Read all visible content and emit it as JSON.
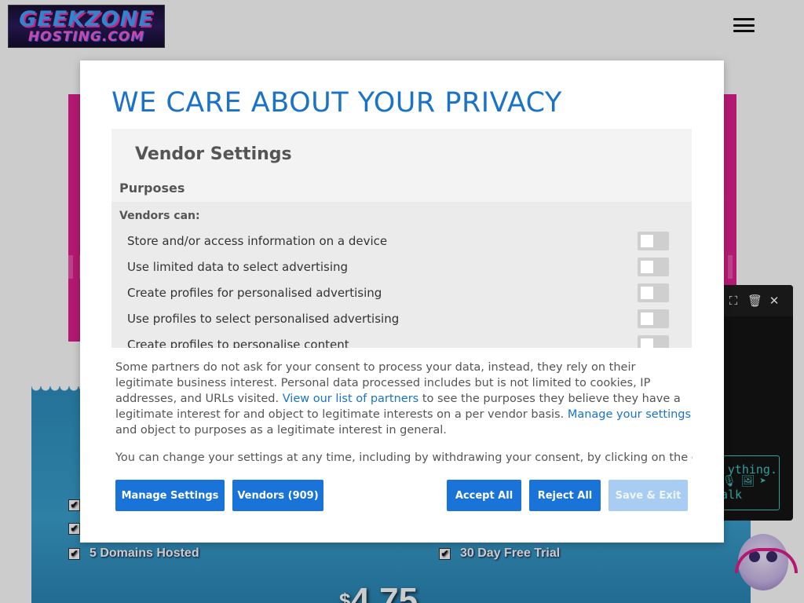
{
  "background": {
    "logo": {
      "line1": "GEEKZONE",
      "line2": "HOSTING.COM"
    },
    "menu_icon": "hamburger-icon",
    "features": [
      {
        "label": "",
        "icon": "checkbox-icon"
      },
      {
        "label": "",
        "icon": "checkbox-icon"
      },
      {
        "label": "5 Domains Hosted",
        "icon": "checkbox-icon"
      },
      {
        "label": "30 Day Free Trial",
        "icon": "checkbox-icon"
      }
    ],
    "check_mark": "✔",
    "price": {
      "currency": "$",
      "amount": "4.75"
    },
    "chat": {
      "expand_icon": "⛶",
      "delete_icon": "🗑",
      "close_icon": "✕",
      "input_line1": "ything.",
      "input_line2": "alk",
      "input_icons": "🎙🖼➤"
    }
  },
  "modal": {
    "title": "WE CARE ABOUT YOUR PRIVACY",
    "vendor_settings_title": "Vendor Settings",
    "purposes_title": "Purposes",
    "vendors_can": "Vendors can:",
    "purposes": [
      {
        "label": "Store and/or access information on a device",
        "enabled": false
      },
      {
        "label": "Use limited data to select advertising",
        "enabled": false
      },
      {
        "label": "Create profiles for personalised advertising",
        "enabled": false
      },
      {
        "label": "Use profiles to select personalised advertising",
        "enabled": false
      },
      {
        "label": "Create profiles to personalise content",
        "enabled": false
      }
    ],
    "info": {
      "part1": "Some partners do not ask for your consent to process your data, instead, they rely on their legitimate business interest. Personal data processed includes but is not limited to cookies, IP addresses, and URLs visited. ",
      "link1": "View our list of partners",
      "part2": " to see the purposes they believe they have a legitimate interest for and object to legitimate interests on a per vendor basis. ",
      "link2": "Manage your settings",
      "part3": " and object to purposes as a legitimate interest in general."
    },
    "cog_text": "You can change your settings at any time, including by withdrawing your consent, by clicking on the cog icon",
    "buttons": {
      "manage": "Manage Settings",
      "vendors": "Vendors (909)",
      "accept": "Accept All",
      "reject": "Reject All",
      "save": "Save & Exit"
    }
  },
  "colors": {
    "accent": "#1a73d9",
    "title_blue": "#1a73c6",
    "disabled_button": "#a9cdf2",
    "hero_pink": "#e0208f",
    "plan_blue": "#2e8fc0"
  }
}
